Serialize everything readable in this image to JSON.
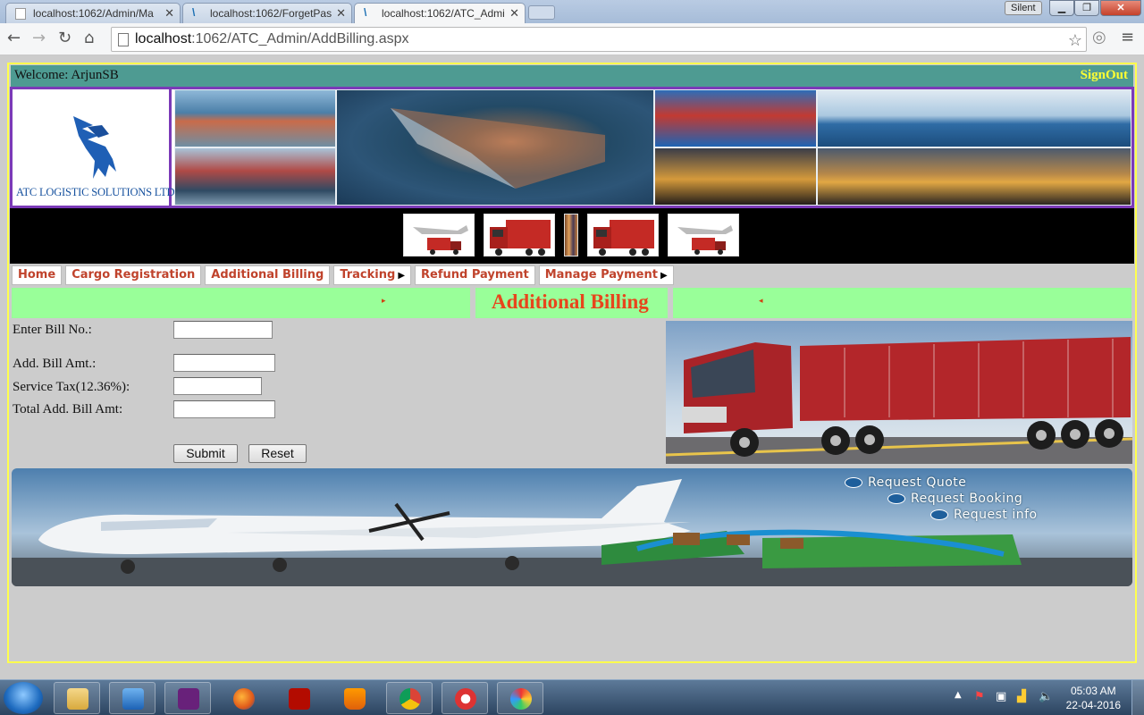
{
  "browser": {
    "tabs": [
      {
        "title": "localhost:1062/Admin/Ma"
      },
      {
        "title": "localhost:1062/ForgetPass"
      },
      {
        "title": "localhost:1062/ATC_Admi"
      }
    ],
    "silent_label": "Silent",
    "window_buttons": {
      "minimize": "▁",
      "restore": "❐",
      "close": "✕"
    },
    "url_host": "localhost",
    "url_rest": ":1062/ATC_Admin/AddBilling.aspx"
  },
  "page": {
    "welcome": "Welcome: ArjunSB",
    "signout": "SignOut",
    "logo_text": "ATC LOGISTIC SOLUTIONS LTD.,",
    "menu": [
      {
        "label": "Home",
        "has_submenu": false
      },
      {
        "label": "Cargo Registration",
        "has_submenu": false
      },
      {
        "label": "Additional Billing",
        "has_submenu": false
      },
      {
        "label": "Tracking",
        "has_submenu": true
      },
      {
        "label": "Refund Payment",
        "has_submenu": false
      },
      {
        "label": "Manage Payment",
        "has_submenu": true
      }
    ],
    "title": "Additional Billing",
    "title_marks": {
      "left": "▸",
      "right": "◂"
    },
    "form": {
      "bill_no_label": "Enter Bill No.:",
      "bill_no_value": "",
      "add_bill_amt_label": "Add. Bill Amt.:",
      "add_bill_amt_value": "",
      "service_tax_label": "Service Tax(12.36%):",
      "service_tax_value": "",
      "total_label": "Total Add. Bill Amt:",
      "total_value": "",
      "submit_label": "Submit",
      "reset_label": "Reset"
    },
    "requests": [
      "Request Quote",
      "Request Booking",
      "Request info"
    ]
  },
  "taskbar": {
    "time": "05:03 AM",
    "date": "22-04-2016"
  },
  "colors": {
    "welcome_bar": "#4e9b92",
    "signout": "#ffff33",
    "banner_border": "#7b3ab8",
    "title_bar": "#99ff99",
    "title_text": "#e8451c",
    "menu_text": "#c0432c"
  }
}
